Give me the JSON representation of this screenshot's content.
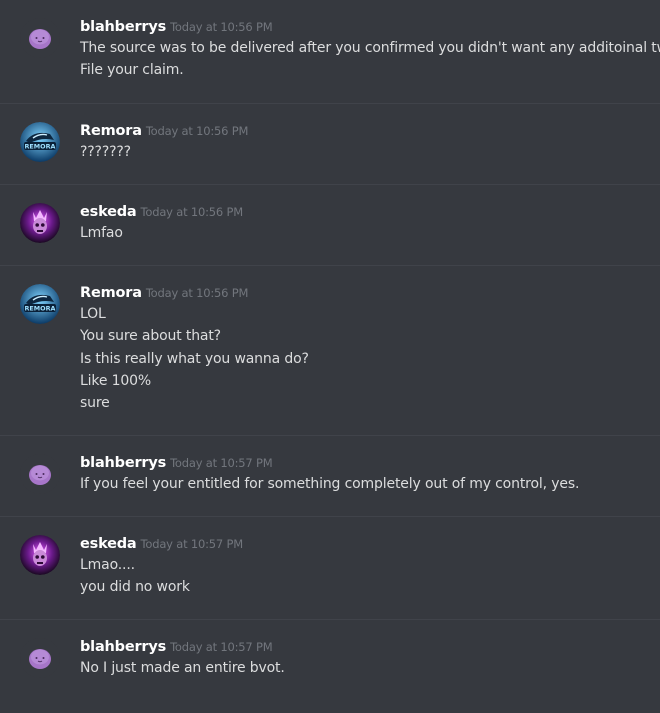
{
  "messages": [
    {
      "author": "blahberrys",
      "avatar_icon": "purple-blob-avatar-icon",
      "time": "Today at 10:56 PM",
      "lines": [
        "The source was to be delivered after you confirmed you didn't want any additoinal tweaks.",
        "File your claim."
      ]
    },
    {
      "author": "Remora",
      "avatar_icon": "shark-logo-avatar-icon",
      "avatar_text": "REMORA",
      "time": "Today at 10:56 PM",
      "lines": [
        "???????"
      ]
    },
    {
      "author": "eskeda",
      "avatar_icon": "purple-skull-avatar-icon",
      "time": "Today at 10:56 PM",
      "lines": [
        "Lmfao"
      ]
    },
    {
      "author": "Remora",
      "avatar_icon": "shark-logo-avatar-icon",
      "avatar_text": "REMORA",
      "time": "Today at 10:56 PM",
      "lines": [
        "LOL",
        "You sure about that?",
        "Is this really what you wanna do?",
        "Like 100%",
        "sure"
      ]
    },
    {
      "author": "blahberrys",
      "avatar_icon": "purple-blob-avatar-icon",
      "time": "Today at 10:57 PM",
      "lines": [
        "If you feel your entitled for something completely out of my control, yes."
      ]
    },
    {
      "author": "eskeda",
      "avatar_icon": "purple-skull-avatar-icon",
      "time": "Today at 10:57 PM",
      "lines": [
        "Lmao....",
        "you did no work"
      ]
    },
    {
      "author": "blahberrys",
      "avatar_icon": "purple-blob-avatar-icon",
      "time": "Today at 10:57 PM",
      "lines": [
        "No I just made an entire bvot."
      ]
    }
  ],
  "colors": {
    "background": "#36393f",
    "divider": "#40434a",
    "username": "#ffffff",
    "timestamp": "#72767d",
    "message_text": "#dcddde"
  }
}
